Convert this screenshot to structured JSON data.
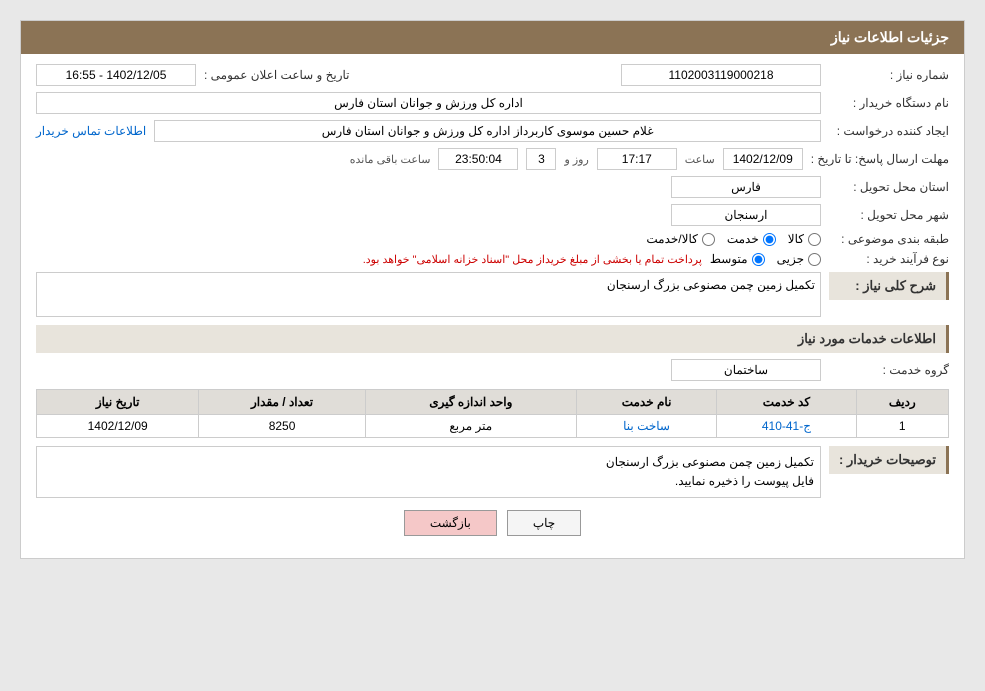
{
  "header": {
    "title": "جزئیات اطلاعات نیاز"
  },
  "fields": {
    "shomara_niaz_label": "شماره نیاز :",
    "shomara_niaz_value": "1102003119000218",
    "nam_dastgah_label": "نام دستگاه خریدار :",
    "nam_dastgah_value": "اداره کل ورزش و جوانان استان فارس",
    "ijad_konande_label": "ایجاد کننده درخواست :",
    "ijad_konande_value": "غلام حسین موسوی کاربرداز اداره کل ورزش و جوانان استان فارس",
    "ettelaat_link": "اطلاعات تماس خریدار",
    "mohlat_label": "مهلت ارسال پاسخ: تا تاریخ :",
    "tarikh_value": "1402/12/09",
    "saat_label": "ساعت",
    "saat_value": "17:17",
    "roz_label": "روز و",
    "roz_value": "3",
    "baqi_mande_value": "23:50:04",
    "baqi_mande_label": "ساعت باقی مانده",
    "tarikh_elan_label": "تاریخ و ساعت اعلان عمومی :",
    "tarikh_elan_value": "1402/12/05 - 16:55",
    "ostan_label": "استان محل تحویل :",
    "ostan_value": "فارس",
    "shahr_label": "شهر محل تحویل :",
    "shahr_value": "ارسنجان",
    "tabaqe_label": "طبقه بندی موضوعی :",
    "tabaqe_options": [
      {
        "label": "کالا",
        "value": "kala"
      },
      {
        "label": "خدمت",
        "value": "khedmat"
      },
      {
        "label": "کالا/خدمت",
        "value": "kala_khedmat"
      }
    ],
    "tabaqe_selected": "khedmat",
    "nooe_farayand_label": "نوع فرآیند خرید :",
    "nooe_farayand_options": [
      {
        "label": "جزیی",
        "value": "jozi"
      },
      {
        "label": "متوسط",
        "value": "motavaset"
      }
    ],
    "nooe_farayand_selected": "motavaset",
    "farayand_note": "پرداخت تمام یا بخشی از مبلغ خریداز محل \"اسناد خزانه اسلامی\" خواهد بود.",
    "sharh_label": "شرح کلی نیاز :",
    "sharh_value": "تکمیل زمین چمن مصنوعی بزرگ ارسنجان"
  },
  "service_section": {
    "title": "اطلاعات خدمات مورد نیاز",
    "group_label": "گروه خدمت :",
    "group_value": "ساختمان",
    "table": {
      "headers": [
        "ردیف",
        "کد خدمت",
        "نام خدمت",
        "واحد اندازه گیری",
        "تعداد / مقدار",
        "تاریخ نیاز"
      ],
      "rows": [
        {
          "radif": "1",
          "kod": "ج-41-410",
          "nam": "ساخت بنا",
          "vahed": "متر مربع",
          "tedad": "8250",
          "tarikh": "1402/12/09"
        }
      ]
    },
    "description_label": "توصیحات خریدار :",
    "description_value": "تکمیل زمین چمن مصنوعی بزرگ ارسنجان\nفایل پیوست را ذخیره نمایید."
  },
  "buttons": {
    "print": "چاپ",
    "back": "بازگشت"
  }
}
